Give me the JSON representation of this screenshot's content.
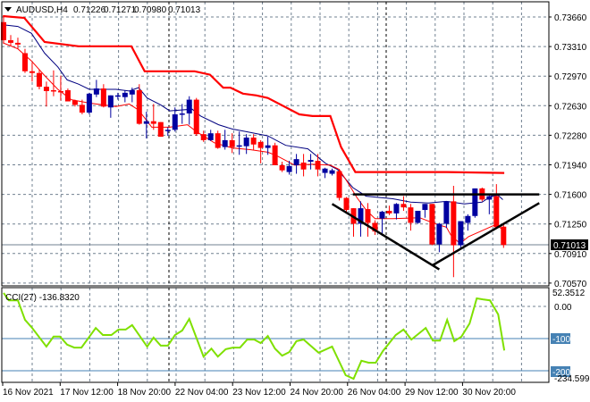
{
  "header": {
    "symbol": "AUDUSD,H4",
    "open": "0.71226",
    "high": "0.71271",
    "low": "0.70980",
    "close": "0.71013"
  },
  "price_axis": {
    "labels": [
      "0.73660",
      "0.73310",
      "0.72970",
      "0.72630",
      "0.72280",
      "0.71940",
      "0.71600",
      "0.71250",
      "0.70910",
      "0.70570"
    ],
    "current_price": "0.71013"
  },
  "cci": {
    "label": "CCI(27) -136.8320",
    "axis_labels": {
      "max": "52.3512",
      "zero": "0.00",
      "minus100": "-100",
      "minus200": "-200",
      "min": "-234.5991"
    },
    "values": [
      [
        0,
        42
      ],
      [
        0.75,
        19
      ],
      [
        2,
        19
      ],
      [
        3,
        -42
      ],
      [
        4,
        -67
      ],
      [
        6,
        -125
      ],
      [
        7,
        -94
      ],
      [
        7.9,
        -94
      ],
      [
        8.9,
        -119
      ],
      [
        9.9,
        -128
      ],
      [
        10.9,
        -128
      ],
      [
        12.9,
        -67
      ],
      [
        13.9,
        -89
      ],
      [
        15.1,
        -89
      ],
      [
        16.1,
        -72
      ],
      [
        17.1,
        -72
      ],
      [
        18,
        -58
      ],
      [
        20.1,
        -125
      ],
      [
        21,
        -97
      ],
      [
        22,
        -122
      ],
      [
        23,
        -122
      ],
      [
        24,
        -89
      ],
      [
        25,
        -75
      ],
      [
        26,
        -39
      ],
      [
        28,
        -156
      ],
      [
        29.1,
        -131
      ],
      [
        30,
        -156
      ],
      [
        31.1,
        -133
      ],
      [
        32.1,
        -128
      ],
      [
        33.1,
        -128
      ],
      [
        34.1,
        -103
      ],
      [
        35.1,
        -103
      ],
      [
        36,
        -114
      ],
      [
        37,
        -92
      ],
      [
        38,
        -131
      ],
      [
        39,
        -153
      ],
      [
        40,
        -142
      ],
      [
        41,
        -108
      ],
      [
        42,
        -103
      ],
      [
        44.1,
        -144
      ],
      [
        46,
        -125
      ],
      [
        47.9,
        -214
      ],
      [
        49,
        -225
      ],
      [
        50.1,
        -169
      ],
      [
        51.1,
        -175
      ],
      [
        52.1,
        -175
      ],
      [
        53.1,
        -139
      ],
      [
        54.9,
        -89
      ],
      [
        56,
        -72
      ],
      [
        57.1,
        -103
      ],
      [
        59.1,
        -67
      ],
      [
        60.1,
        -106
      ],
      [
        61.1,
        -106
      ],
      [
        62.1,
        -42
      ],
      [
        63.1,
        -108
      ],
      [
        64.1,
        -94
      ],
      [
        65.25,
        -53
      ],
      [
        66.25,
        25
      ],
      [
        67.1,
        22
      ],
      [
        68.1,
        19
      ],
      [
        69.25,
        -25
      ],
      [
        70.1,
        -137
      ]
    ]
  },
  "time_axis": {
    "labels": [
      "16 Nov 2021",
      "17 Nov 12:00",
      "18 Nov 20:00",
      "22 Nov 04:00",
      "23 Nov 12:00",
      "24 Nov 20:00",
      "26 Nov 04:00",
      "29 Nov 12:00",
      "30 Nov 20:00"
    ]
  },
  "colors": {
    "bull": "#0000A0",
    "bear": "#FF0000",
    "slow_line": "#FF0000",
    "ma_blue": "#000080",
    "ma_red": "#FF0000",
    "cci": "#7FE000",
    "level": "#4682B4",
    "grid": "#708090"
  },
  "chart_data": {
    "type": "candlestick",
    "title": "AUDUSD,H4",
    "ylim": [
      0.7057,
      0.7366
    ],
    "candles_ohlc": [
      [
        0.736,
        0.7367,
        0.7336,
        0.7339
      ],
      [
        0.7339,
        0.7345,
        0.7332,
        0.7336
      ],
      [
        0.7336,
        0.7342,
        0.7329,
        0.7334
      ],
      [
        0.7324,
        0.7329,
        0.7301,
        0.7303
      ],
      [
        0.7303,
        0.7313,
        0.7291,
        0.7301
      ],
      [
        0.7301,
        0.7305,
        0.7282,
        0.7285
      ],
      [
        0.7285,
        0.7291,
        0.7262,
        0.728
      ],
      [
        0.7281,
        0.7304,
        0.7274,
        0.728
      ],
      [
        0.728,
        0.7298,
        0.7269,
        0.7279
      ],
      [
        0.7281,
        0.7283,
        0.7268,
        0.7268
      ],
      [
        0.7269,
        0.727,
        0.7262,
        0.7264
      ],
      [
        0.7264,
        0.727,
        0.7253,
        0.7255
      ],
      [
        0.7255,
        0.7278,
        0.7253,
        0.7277
      ],
      [
        0.7276,
        0.7293,
        0.7273,
        0.7283
      ],
      [
        0.7283,
        0.7288,
        0.7261,
        0.7262
      ],
      [
        0.7261,
        0.7275,
        0.7249,
        0.7275
      ],
      [
        0.7274,
        0.7278,
        0.727,
        0.7275
      ],
      [
        0.7273,
        0.7281,
        0.7267,
        0.7278
      ],
      [
        0.7276,
        0.7284,
        0.7267,
        0.7281
      ],
      [
        0.7281,
        0.7288,
        0.7241,
        0.7242
      ],
      [
        0.7242,
        0.7256,
        0.7225,
        0.7245
      ],
      [
        0.7245,
        0.7265,
        0.7235,
        0.7242
      ],
      [
        0.7244,
        0.7244,
        0.7227,
        0.7227
      ],
      [
        0.7234,
        0.7238,
        0.7228,
        0.7235
      ],
      [
        0.7235,
        0.7261,
        0.7233,
        0.7253
      ],
      [
        0.7253,
        0.7265,
        0.7242,
        0.7254
      ],
      [
        0.7254,
        0.7274,
        0.7241,
        0.727
      ],
      [
        0.727,
        0.7272,
        0.7228,
        0.723
      ],
      [
        0.723,
        0.7234,
        0.7221,
        0.7223
      ],
      [
        0.7223,
        0.7235,
        0.7222,
        0.7231
      ],
      [
        0.7231,
        0.7234,
        0.7213,
        0.7214
      ],
      [
        0.7215,
        0.7235,
        0.7212,
        0.7223
      ],
      [
        0.7223,
        0.7231,
        0.7208,
        0.7215
      ],
      [
        0.7216,
        0.7233,
        0.7206,
        0.7217
      ],
      [
        0.7216,
        0.723,
        0.7207,
        0.7226
      ],
      [
        0.7226,
        0.723,
        0.7212,
        0.7218
      ],
      [
        0.7221,
        0.7223,
        0.7196,
        0.7214
      ],
      [
        0.7214,
        0.7227,
        0.7206,
        0.7217
      ],
      [
        0.7217,
        0.722,
        0.7194,
        0.7194
      ],
      [
        0.7194,
        0.7198,
        0.7186,
        0.7188
      ],
      [
        0.7186,
        0.7199,
        0.7183,
        0.7193
      ],
      [
        0.7194,
        0.7207,
        0.7184,
        0.7201
      ],
      [
        0.7197,
        0.7207,
        0.7181,
        0.7189
      ],
      [
        0.7198,
        0.7207,
        0.7189,
        0.72
      ],
      [
        0.7199,
        0.7207,
        0.7181,
        0.7189
      ],
      [
        0.7185,
        0.7191,
        0.7179,
        0.719
      ],
      [
        0.7184,
        0.719,
        0.7182,
        0.7188
      ],
      [
        0.7187,
        0.7189,
        0.7153,
        0.7156
      ],
      [
        0.7156,
        0.7157,
        0.7139,
        0.7142
      ],
      [
        0.7144,
        0.7144,
        0.7111,
        0.7126
      ],
      [
        0.7126,
        0.7152,
        0.7111,
        0.7144
      ],
      [
        0.7143,
        0.715,
        0.7111,
        0.7127
      ],
      [
        0.7127,
        0.713,
        0.7113,
        0.7117
      ],
      [
        0.7132,
        0.7141,
        0.7112,
        0.714
      ],
      [
        0.7141,
        0.7147,
        0.7136,
        0.7138
      ],
      [
        0.7138,
        0.715,
        0.7131,
        0.7149
      ],
      [
        0.7149,
        0.7158,
        0.7141,
        0.7145
      ],
      [
        0.7145,
        0.7149,
        0.7118,
        0.7127
      ],
      [
        0.7127,
        0.7141,
        0.7126,
        0.7141
      ],
      [
        0.7142,
        0.7149,
        0.7133,
        0.7149
      ],
      [
        0.7149,
        0.7149,
        0.7101,
        0.7102
      ],
      [
        0.7102,
        0.7127,
        0.7093,
        0.7126
      ],
      [
        0.7126,
        0.7152,
        0.7121,
        0.7152
      ],
      [
        0.7152,
        0.717,
        0.7064,
        0.7101
      ],
      [
        0.7101,
        0.7129,
        0.7096,
        0.7129
      ],
      [
        0.7127,
        0.7137,
        0.7118,
        0.7135
      ],
      [
        0.7135,
        0.7167,
        0.7133,
        0.7167
      ],
      [
        0.7167,
        0.7168,
        0.7152,
        0.7154
      ],
      [
        0.7154,
        0.716,
        0.7137,
        0.7158
      ],
      [
        0.7158,
        0.7172,
        0.7122,
        0.7122
      ],
      [
        0.71226,
        0.71271,
        0.7098,
        0.71013
      ]
    ],
    "slow_line": [
      [
        -0.1,
        0.7367
      ],
      [
        2.9,
        0.7365
      ],
      [
        5.75,
        0.7337
      ],
      [
        10.5,
        0.7332
      ],
      [
        17.9,
        0.7332
      ],
      [
        19.75,
        0.7303
      ],
      [
        26.75,
        0.7303
      ],
      [
        28.9,
        0.7299
      ],
      [
        30.75,
        0.7284
      ],
      [
        31.75,
        0.7284
      ],
      [
        33.5,
        0.7277
      ],
      [
        35.4,
        0.7275
      ],
      [
        37,
        0.7272
      ],
      [
        41.4,
        0.7253
      ],
      [
        43.25,
        0.7251
      ],
      [
        45.75,
        0.7251
      ],
      [
        47.25,
        0.7215
      ],
      [
        49.25,
        0.7186
      ],
      [
        62,
        0.7186
      ],
      [
        70.1,
        0.7185
      ]
    ],
    "ma_blue": [
      [
        -0.1,
        0.7357
      ],
      [
        2,
        0.7355
      ],
      [
        3.9,
        0.7347
      ],
      [
        5.75,
        0.7324
      ],
      [
        7.6,
        0.7308
      ],
      [
        8.9,
        0.7293
      ],
      [
        10.5,
        0.7288
      ],
      [
        12,
        0.7282
      ],
      [
        15.75,
        0.7282
      ],
      [
        17.6,
        0.728
      ],
      [
        18.9,
        0.7284
      ],
      [
        20.1,
        0.7272
      ],
      [
        22,
        0.7264
      ],
      [
        23.25,
        0.7257
      ],
      [
        26.4,
        0.7259
      ],
      [
        27.6,
        0.7251
      ],
      [
        30.1,
        0.7241
      ],
      [
        32,
        0.7236
      ],
      [
        33.9,
        0.7233
      ],
      [
        37,
        0.7228
      ],
      [
        39.5,
        0.7217
      ],
      [
        42.6,
        0.7213
      ],
      [
        45.1,
        0.7196
      ],
      [
        46.75,
        0.7189
      ],
      [
        48.9,
        0.7168
      ],
      [
        50.75,
        0.7158
      ],
      [
        54.5,
        0.7155
      ],
      [
        57,
        0.7151
      ],
      [
        59.5,
        0.715
      ],
      [
        62,
        0.7152
      ],
      [
        64.5,
        0.7149
      ],
      [
        67,
        0.7151
      ],
      [
        68.25,
        0.7158
      ],
      [
        69.25,
        0.7159
      ],
      [
        69.9,
        0.7154
      ]
    ],
    "ma_red": [
      [
        -0.1,
        0.7336
      ],
      [
        2,
        0.7329
      ],
      [
        3.9,
        0.7315
      ],
      [
        5.75,
        0.7298
      ],
      [
        7.6,
        0.7282
      ],
      [
        9.5,
        0.727
      ],
      [
        12,
        0.7266
      ],
      [
        15.75,
        0.7262
      ],
      [
        17.6,
        0.7265
      ],
      [
        18.9,
        0.7258
      ],
      [
        20.75,
        0.7238
      ],
      [
        23.25,
        0.7238
      ],
      [
        25.75,
        0.7241
      ],
      [
        27,
        0.7233
      ],
      [
        29.5,
        0.722
      ],
      [
        32,
        0.7214
      ],
      [
        34.5,
        0.7212
      ],
      [
        37,
        0.7209
      ],
      [
        38.25,
        0.7205
      ],
      [
        40.75,
        0.7194
      ],
      [
        43.25,
        0.7195
      ],
      [
        45.75,
        0.7194
      ],
      [
        47,
        0.7189
      ],
      [
        48.25,
        0.7173
      ],
      [
        49.5,
        0.7156
      ],
      [
        50.75,
        0.7142
      ],
      [
        52,
        0.7132
      ],
      [
        54.5,
        0.7132
      ],
      [
        58.25,
        0.7133
      ],
      [
        60.75,
        0.7125
      ],
      [
        62,
        0.7122
      ],
      [
        62.6,
        0.7113
      ],
      [
        63.9,
        0.7103
      ],
      [
        65.1,
        0.7111
      ],
      [
        67,
        0.7118
      ],
      [
        68.9,
        0.7125
      ],
      [
        69.75,
        0.712
      ]
    ],
    "trendlines": [
      [
        [
          48.9,
          0.716
        ],
        [
          75,
          0.716
        ]
      ],
      [
        [
          46,
          0.7149
        ],
        [
          61,
          0.7073
        ]
      ],
      [
        [
          60.1,
          0.7078
        ],
        [
          75,
          0.715
        ]
      ]
    ]
  }
}
